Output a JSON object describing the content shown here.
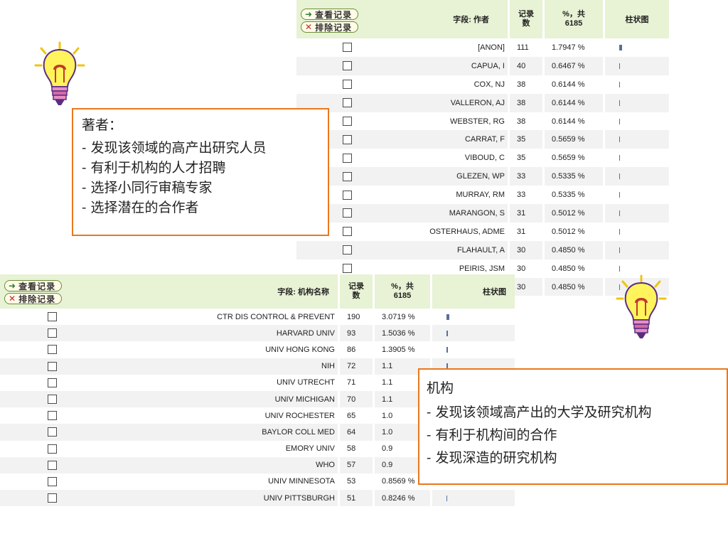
{
  "top_table": {
    "view_button": "查看记录",
    "exclude_button": "排除记录",
    "headers": {
      "field": "字段: 作者",
      "count": "记录数",
      "percent": "%，共 6185",
      "bar": "柱状图"
    },
    "rows": [
      {
        "name": "[ANON]",
        "count": "111",
        "percent": "1.7947 %",
        "fraction": 1.7947
      },
      {
        "name": "CAPUA, I",
        "count": "40",
        "percent": "0.6467 %",
        "fraction": 0.6467
      },
      {
        "name": "COX, NJ",
        "count": "38",
        "percent": "0.6144 %",
        "fraction": 0.6144
      },
      {
        "name": "VALLERON, AJ",
        "count": "38",
        "percent": "0.6144 %",
        "fraction": 0.6144
      },
      {
        "name": "WEBSTER, RG",
        "count": "38",
        "percent": "0.6144 %",
        "fraction": 0.6144
      },
      {
        "name": "CARRAT, F",
        "count": "35",
        "percent": "0.5659 %",
        "fraction": 0.5659
      },
      {
        "name": "VIBOUD, C",
        "count": "35",
        "percent": "0.5659 %",
        "fraction": 0.5659
      },
      {
        "name": "GLEZEN, WP",
        "count": "33",
        "percent": "0.5335 %",
        "fraction": 0.5335
      },
      {
        "name": "MURRAY, RM",
        "count": "33",
        "percent": "0.5335 %",
        "fraction": 0.5335
      },
      {
        "name": "MARANGON, S",
        "count": "31",
        "percent": "0.5012 %",
        "fraction": 0.5012
      },
      {
        "name": "OSTERHAUS, ADME",
        "count": "31",
        "percent": "0.5012 %",
        "fraction": 0.5012
      },
      {
        "name": "FLAHAULT, A",
        "count": "30",
        "percent": "0.4850 %",
        "fraction": 0.485
      },
      {
        "name": "PEIRIS, JSM",
        "count": "30",
        "percent": "0.4850 %",
        "fraction": 0.485
      },
      {
        "name": "",
        "count": "30",
        "percent": "0.4850 %",
        "fraction": 0.485
      }
    ]
  },
  "bottom_table": {
    "view_button": "查看记录",
    "exclude_button": "排除记录",
    "headers": {
      "field": "字段: 机构名称",
      "count": "记录数",
      "percent": "%，共 6185",
      "bar": "柱状图"
    },
    "rows": [
      {
        "name": "CTR DIS CONTROL & PREVENT",
        "count": "190",
        "percent": "3.0719 %",
        "fraction": 3.0719
      },
      {
        "name": "HARVARD UNIV",
        "count": "93",
        "percent": "1.5036 %",
        "fraction": 1.5036
      },
      {
        "name": "UNIV HONG KONG",
        "count": "86",
        "percent": "1.3905 %",
        "fraction": 1.3905
      },
      {
        "name": "NIH",
        "count": "72",
        "percent": "1.1",
        "fraction": 1.16
      },
      {
        "name": "UNIV UTRECHT",
        "count": "71",
        "percent": "1.1",
        "fraction": 1.15
      },
      {
        "name": "UNIV MICHIGAN",
        "count": "70",
        "percent": "1.1",
        "fraction": 1.13
      },
      {
        "name": "UNIV ROCHESTER",
        "count": "65",
        "percent": "1.0",
        "fraction": 1.05
      },
      {
        "name": "BAYLOR COLL MED",
        "count": "64",
        "percent": "1.0",
        "fraction": 1.03
      },
      {
        "name": "EMORY UNIV",
        "count": "58",
        "percent": "0.9",
        "fraction": 0.94
      },
      {
        "name": "WHO",
        "count": "57",
        "percent": "0.9",
        "fraction": 0.92
      },
      {
        "name": "UNIV MINNESOTA",
        "count": "53",
        "percent": "0.8569 %",
        "fraction": 0.8569
      },
      {
        "name": "UNIV PITTSBURGH",
        "count": "51",
        "percent": "0.8246 %",
        "fraction": 0.8246
      }
    ]
  },
  "author_callout": {
    "title": "著者：",
    "lines": [
      "- 发现该领域的高产出研究人员",
      "- 有利于机构的人才招聘",
      "- 选择小同行审稿专家",
      "- 选择潜在的合作者"
    ]
  },
  "institution_callout": {
    "title": "机构",
    "lines": [
      "- 发现该领域高产出的大学及研究机构",
      "- 有利于机构间的合作",
      "- 发现深造的研究机构"
    ]
  },
  "icons": {
    "bulb": "lightbulb-icon",
    "checkbox": "checkbox-icon",
    "arrow": "right-arrow-icon",
    "cross": "cross-icon"
  },
  "colors": {
    "header_bg": "#e8f2d4",
    "callout_border": "#e8781e",
    "bar": "#5a6e9a",
    "stripe": "#f2f2f2"
  }
}
